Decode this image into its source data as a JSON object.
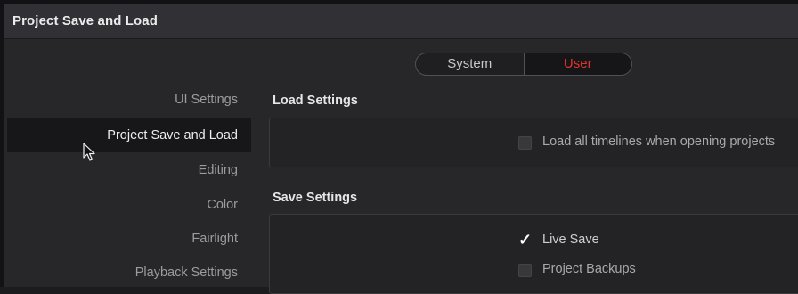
{
  "window": {
    "title": "Project Save and Load"
  },
  "toggle": {
    "options": [
      "System",
      "User"
    ],
    "selected": "User"
  },
  "sidebar": {
    "items": [
      {
        "label": "UI Settings",
        "active": false
      },
      {
        "label": "Project Save and Load",
        "active": true
      },
      {
        "label": "Editing",
        "active": false
      },
      {
        "label": "Color",
        "active": false
      },
      {
        "label": "Fairlight",
        "active": false
      },
      {
        "label": "Playback Settings",
        "active": false
      }
    ]
  },
  "load_settings": {
    "heading": "Load Settings",
    "options": [
      {
        "label": "Load all timelines when opening projects",
        "checked": false
      }
    ]
  },
  "save_settings": {
    "heading": "Save Settings",
    "options": [
      {
        "label": "Live Save",
        "checked": true
      },
      {
        "label": "Project Backups",
        "checked": false
      }
    ]
  },
  "colors": {
    "accent_red": "#e4332c",
    "background": "#27272a",
    "active_row": "#17171a"
  },
  "icons": {
    "cursor": "mouse-pointer-icon",
    "check": "checkmark-icon"
  }
}
